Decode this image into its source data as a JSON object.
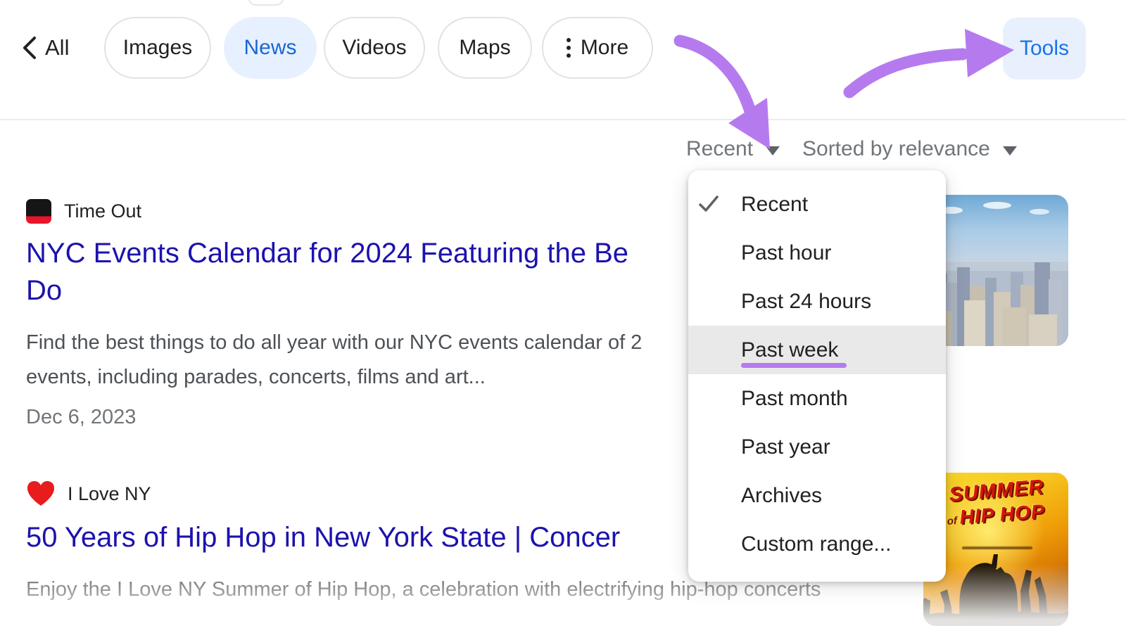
{
  "nav": {
    "back_label": "All",
    "tabs": [
      {
        "label": "Images",
        "active": false
      },
      {
        "label": "News",
        "active": true
      },
      {
        "label": "Videos",
        "active": false
      },
      {
        "label": "Maps",
        "active": false
      },
      {
        "label": "More",
        "active": false,
        "icon": "vertical-ellipsis"
      }
    ],
    "tools_label": "Tools"
  },
  "filters": {
    "time_filter_label": "Recent",
    "sort_filter_label": "Sorted by relevance"
  },
  "dropdown": {
    "items": [
      {
        "label": "Recent",
        "checked": true
      },
      {
        "label": "Past hour"
      },
      {
        "label": "Past 24 hours"
      },
      {
        "label": "Past week",
        "highlighted": true,
        "underlined": true
      },
      {
        "label": "Past month"
      },
      {
        "label": "Past year"
      },
      {
        "label": "Archives"
      },
      {
        "label": "Custom range..."
      }
    ]
  },
  "results": [
    {
      "source": "Time Out",
      "source_icon": "time-out-favicon",
      "title_line1": "NYC Events Calendar for 2024 Featuring the Be",
      "title_line2": "Do",
      "snippet_line1": "Find the best things to do all year with our NYC events calendar of 2",
      "snippet_line2": "events, including parades, concerts, films and art...",
      "date": "Dec 6, 2023",
      "thumbnail": "nyc-skyline-photo"
    },
    {
      "source": "I Love NY",
      "source_icon": "red-heart",
      "title_line1": "50 Years of Hip Hop in New York State | Concer",
      "snippet_line1": "Enjoy the I Love NY Summer of Hip Hop, a celebration with electrifying hip-hop concerts",
      "thumbnail": "summer-of-hip-hop-poster"
    }
  ],
  "poster": {
    "word1": "SUMMER",
    "word2_prefix": "of",
    "word2": "HIP HOP"
  },
  "colors": {
    "annotation_purple": "#b57bee",
    "link_blue": "#1c12ae",
    "active_tab_blue": "#1967d2",
    "active_tab_bg": "#e7f0fe",
    "tools_blue": "#1a73e8",
    "tools_bg": "#e8f0fd",
    "favicon_red": "#e8152d",
    "heart_red": "#e81c1c",
    "snippet_gray": "#4d5156",
    "filter_gray": "#70757a",
    "highlight_row_gray": "#e9e9e9"
  }
}
